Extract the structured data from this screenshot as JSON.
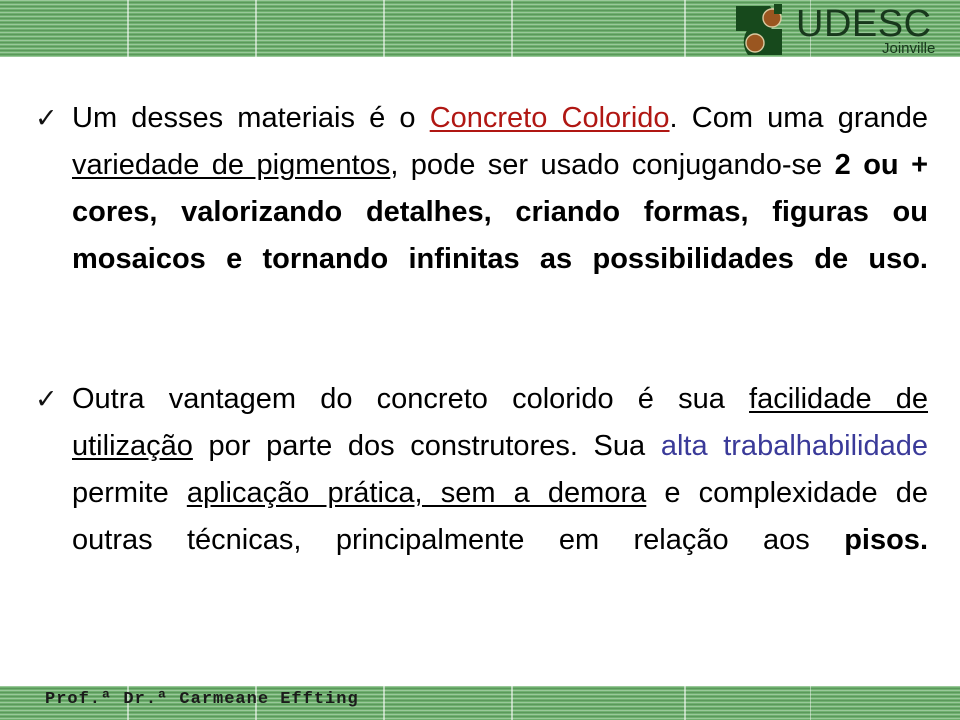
{
  "slide": {
    "background_color": "#ffffff",
    "bar_color": "#6fb06f",
    "accent_red": "#b01713",
    "accent_blue": "#3a3a99"
  },
  "header": {
    "logo": {
      "name": "udesc-logo",
      "wordmark": "UDESC",
      "campus": "Joinville",
      "mark_color": "#17491c",
      "dot_color": "#9a5620"
    }
  },
  "body": {
    "bullets": [
      {
        "marker": "✓",
        "segments": [
          {
            "text": "Um desses materiais é o ",
            "style": "normal"
          },
          {
            "text": "Concreto Colorido",
            "style": "red-underline"
          },
          {
            "text": ". Com uma grande ",
            "style": "normal"
          },
          {
            "text": "variedade de pigmentos",
            "style": "underline"
          },
          {
            "text": ", pode ser usado conjugando-se ",
            "style": "normal"
          },
          {
            "text": "2 ou + cores, valorizando detalhes, criando formas, figuras ou mosaicos e tornando infinitas as possibilidades de uso.",
            "style": "bold"
          }
        ]
      },
      {
        "marker": "✓",
        "segments": [
          {
            "text": "Outra vantagem do concreto colorido é sua ",
            "style": "normal"
          },
          {
            "text": "facilidade de utilização",
            "style": "underline"
          },
          {
            "text": " por parte dos construtores. Sua ",
            "style": "normal"
          },
          {
            "text": "alta trabalhabilidade",
            "style": "blue"
          },
          {
            "text": " permite ",
            "style": "normal"
          },
          {
            "text": "aplicação prática, sem a demora",
            "style": "underline"
          },
          {
            "text": " e complexidade de outras técnicas, principalmente em relação aos ",
            "style": "normal"
          },
          {
            "text": "pisos",
            "style": "bold"
          },
          {
            "text": ".",
            "style": "bold"
          }
        ]
      }
    ]
  },
  "footer": {
    "author": "Prof.ª Dr.ª Carmeane Effting"
  }
}
